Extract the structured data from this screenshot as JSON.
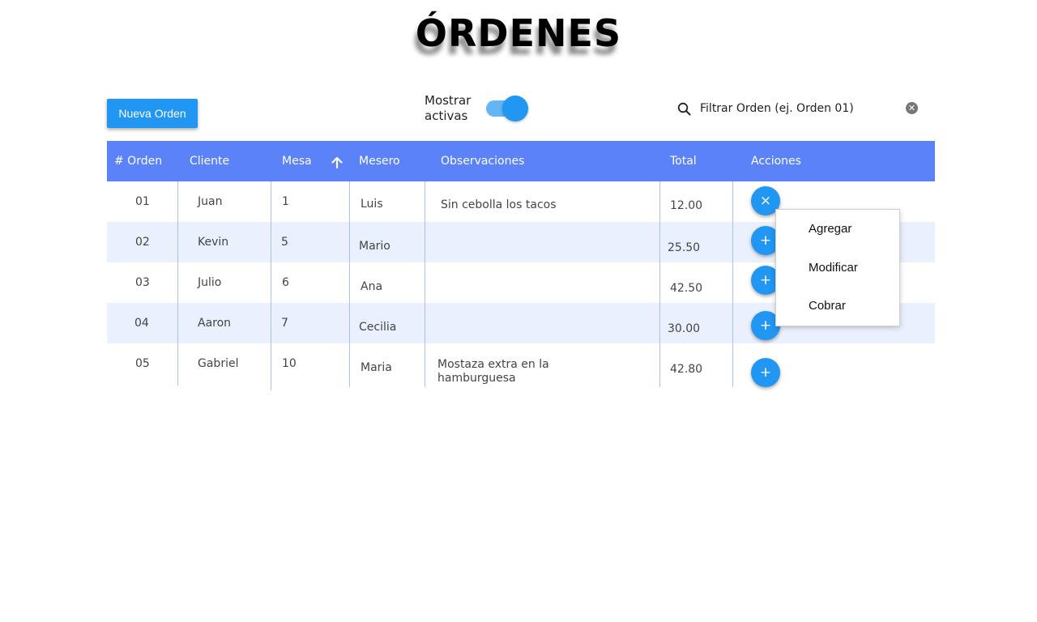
{
  "title": "ÓRDENES",
  "toolbar": {
    "new_order_label": "Nueva Orden",
    "toggle_label": "Mostrar activas",
    "toggle_on": true,
    "search_placeholder": "Filtrar Orden (ej. Orden 01)",
    "search_value": ""
  },
  "table": {
    "headers": {
      "order": "# Orden",
      "client": "Cliente",
      "table": "Mesa",
      "waiter": "Mesero",
      "notes": "Observaciones",
      "total": "Total",
      "actions": "Acciones"
    },
    "sort": {
      "column": "Mesa",
      "direction": "asc"
    },
    "rows": [
      {
        "order": "01",
        "client": "Juan",
        "table": "1",
        "waiter": "Luis",
        "notes": "Sin cebolla los tacos",
        "total": "12.00",
        "action": "×"
      },
      {
        "order": "02",
        "client": "Kevin",
        "table": "5",
        "waiter": "Mario",
        "notes": "",
        "total": "25.50",
        "action": "+"
      },
      {
        "order": "03",
        "client": "Julio",
        "table": "6",
        "waiter": "Ana",
        "notes": "",
        "total": "42.50",
        "action": "+"
      },
      {
        "order": "04",
        "client": "Aaron",
        "table": "7",
        "waiter": "Cecilia",
        "notes": "",
        "total": "30.00",
        "action": "+"
      },
      {
        "order": "05",
        "client": "Gabriel",
        "table": "10",
        "waiter": "Maria",
        "notes": "Mostaza extra en la hamburguesa",
        "total": "42.80",
        "action": "+"
      }
    ]
  },
  "action_menu": {
    "items": [
      "Agregar",
      "Modificar",
      "Cobrar"
    ]
  },
  "colors": {
    "primary": "#2196f3",
    "header": "#5b82f8",
    "row_alt": "#eaf0fd",
    "divider": "#a8c2f5"
  }
}
